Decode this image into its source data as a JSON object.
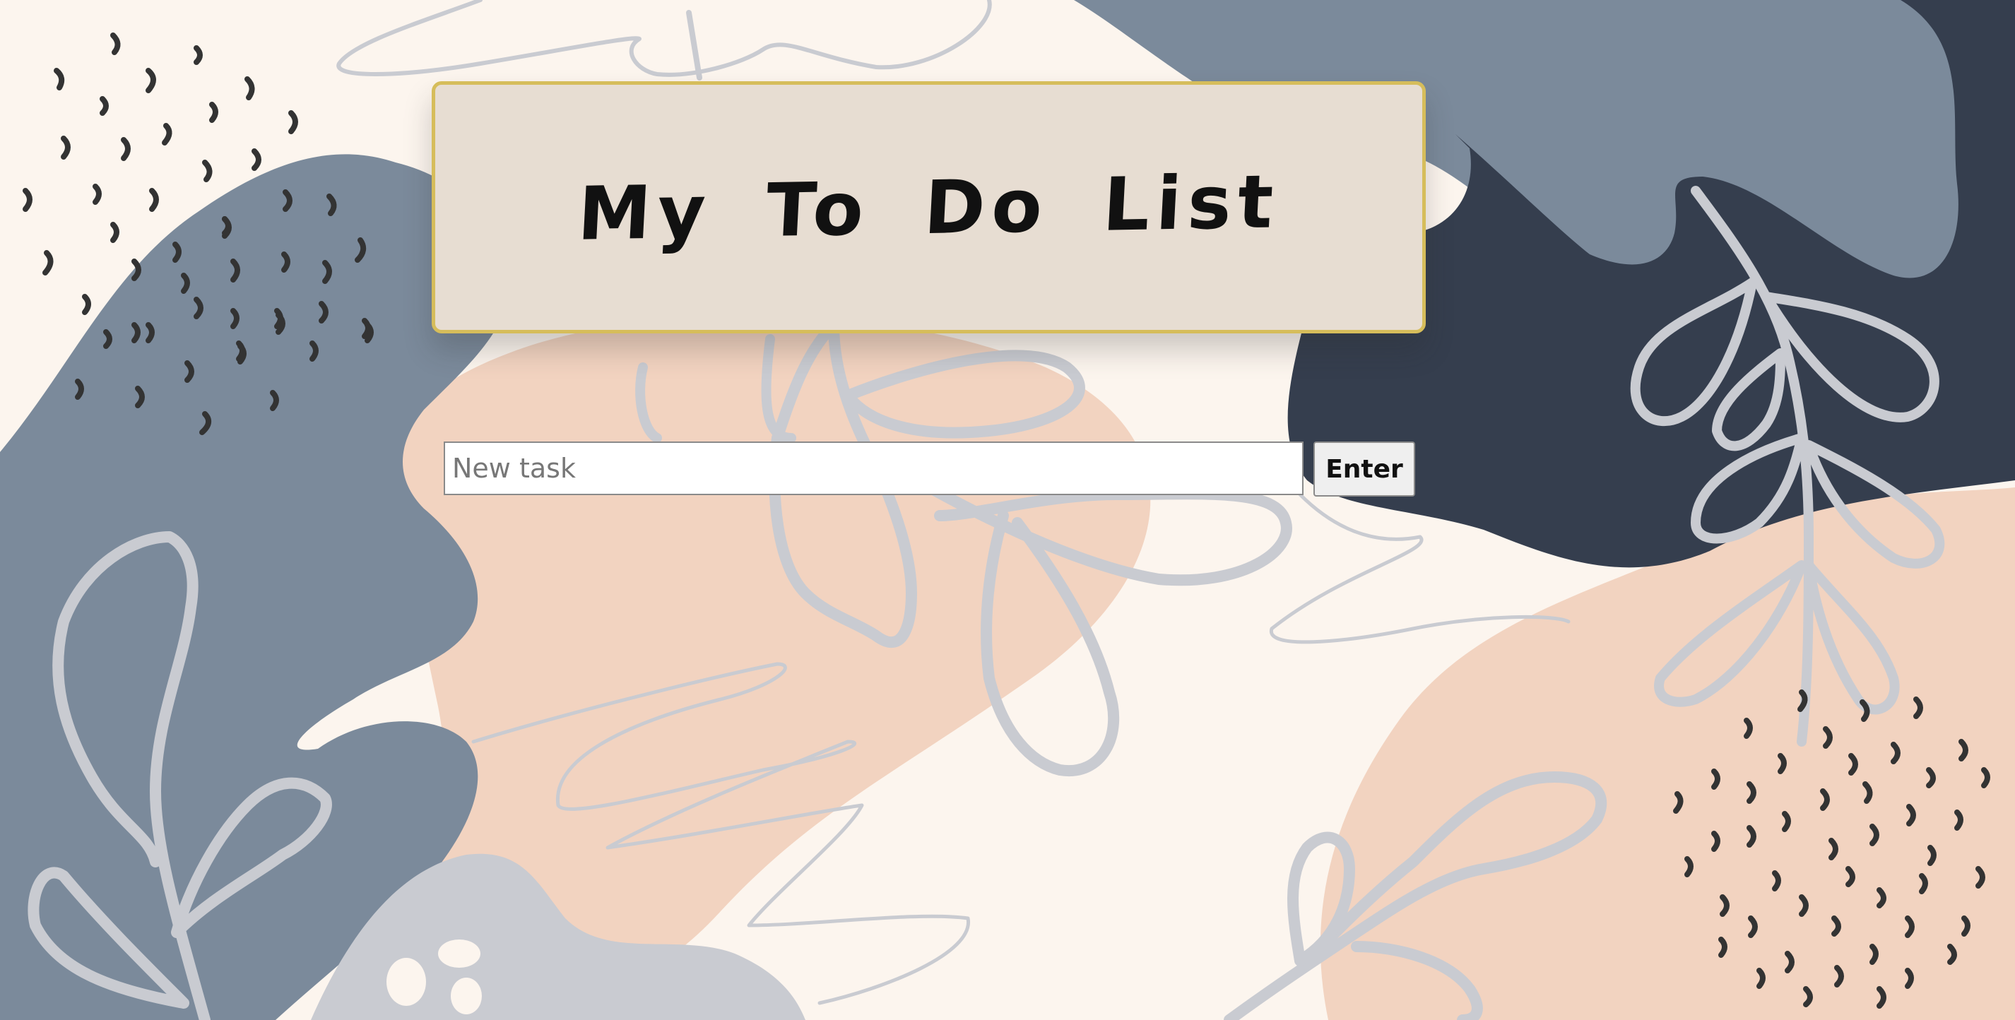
{
  "page": {
    "title": "My To Do List"
  },
  "form": {
    "placeholder": "New task",
    "value": "",
    "enter_label": "Enter"
  },
  "tasks": [],
  "colors": {
    "background": "#fcf5ee",
    "slate": "#7b8a9b",
    "navy": "#353e4e",
    "peach": "#f2d3c0",
    "leaf": "#c9cbd1",
    "dots": "#333333",
    "card": "#e7ddd2",
    "card_border": "#d6bd5b"
  }
}
